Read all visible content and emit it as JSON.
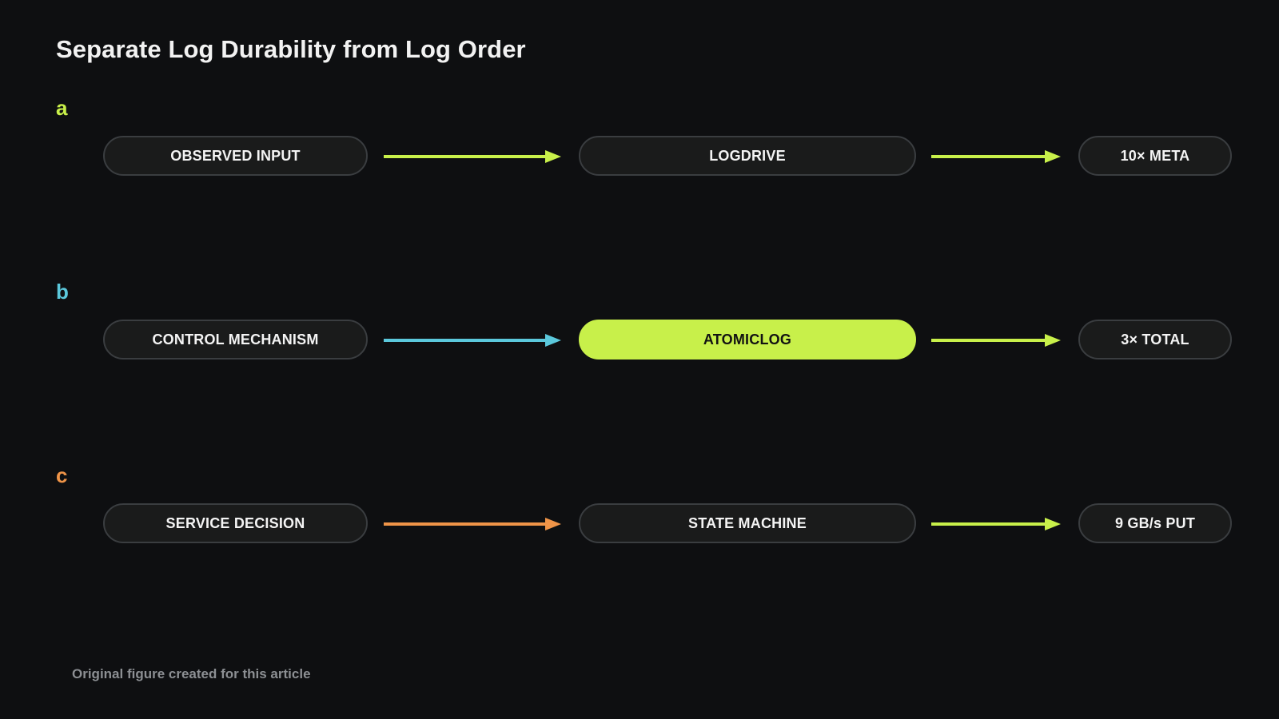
{
  "title": "Separate Log Durability from Log Order",
  "colors": {
    "lime": "#c8f04a",
    "cyan": "#5bc8dc",
    "orange": "#ef9448",
    "node_bg": "#1a1b1b",
    "node_border": "#3a3d40",
    "background": "#0e0f11"
  },
  "rows": [
    {
      "label": "a",
      "label_color": "#c8f04a",
      "input": "OBSERVED INPUT",
      "input_arrow_color": "#c8f04a",
      "middle": "LOGDRIVE",
      "middle_highlighted": false,
      "output_arrow_color": "#c8f04a",
      "output": "10× META"
    },
    {
      "label": "b",
      "label_color": "#5bc8dc",
      "input": "CONTROL MECHANISM",
      "input_arrow_color": "#5bc8dc",
      "middle": "ATOMICLOG",
      "middle_highlighted": true,
      "output_arrow_color": "#c8f04a",
      "output": "3× TOTAL"
    },
    {
      "label": "c",
      "label_color": "#ef9448",
      "input": "SERVICE DECISION",
      "input_arrow_color": "#ef9448",
      "middle": "STATE MACHINE",
      "middle_highlighted": false,
      "output_arrow_color": "#c8f04a",
      "output": "9 GB/s PUT"
    }
  ],
  "caption": "Original figure created for this article"
}
